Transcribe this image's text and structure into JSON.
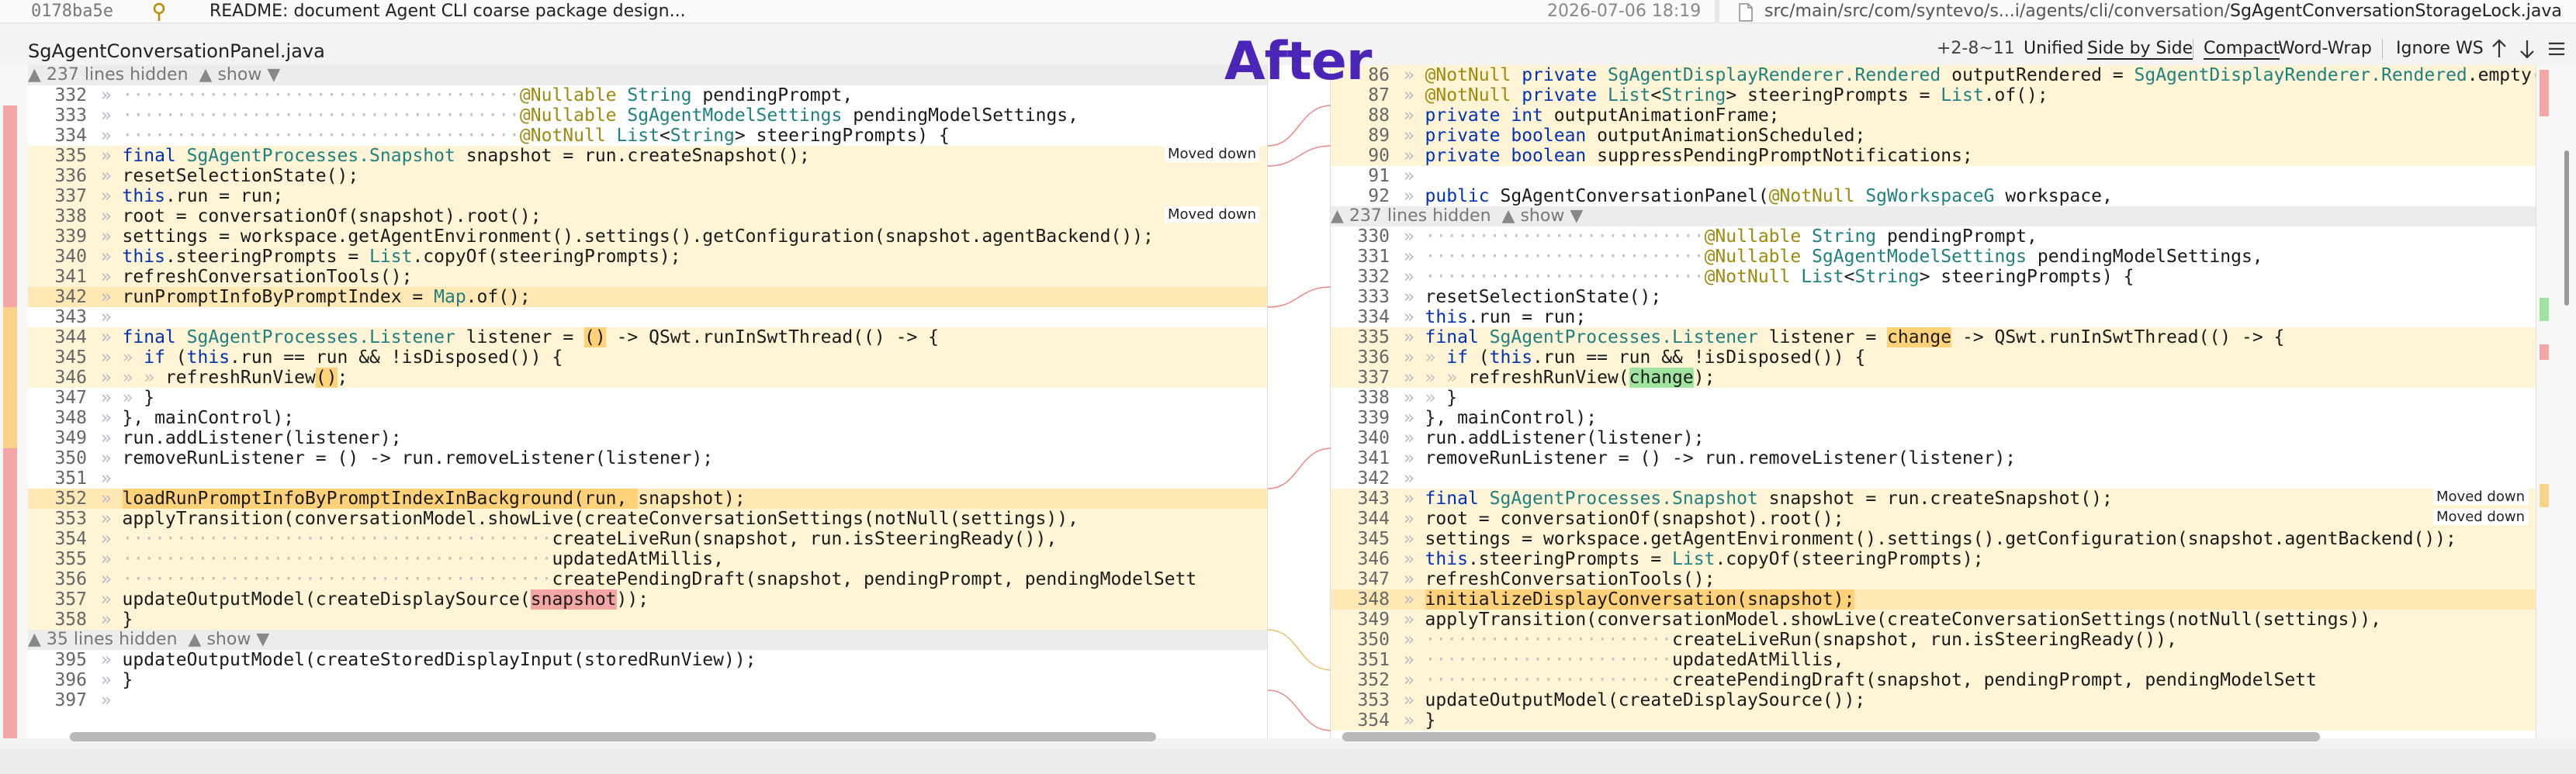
{
  "top_strip": {
    "commit_hash": "0178ba5e",
    "commit_message": "README: document Agent CLI coarse package design...",
    "commit_date": "2026-07-06 18:19",
    "path_prefix": "src/main/src/com/syntevo/s...i/agents/cli/conversation/",
    "path_file": "SgAgentConversationStorageLock.java"
  },
  "header": {
    "file_title": "SgAgentConversationPanel.java",
    "overlay_label": "After",
    "change_count": "+2-8~11",
    "unified": "Unified",
    "side_by_side": "Side by Side",
    "compact": "Compact",
    "word_wrap": "Word-Wrap",
    "ignore_ws": "Ignore WS",
    "icons": [
      "arrow-up-icon",
      "arrow-down-icon",
      "menu-icon"
    ]
  },
  "left_pane": {
    "fold_top": "237 lines hidden",
    "fold_top_show": "show",
    "lines": [
      {
        "n": "332",
        "text": "@Nullable String pendingPrompt,"
      },
      {
        "n": "333",
        "text": "@Nullable SgAgentModelSettings pendingModelSettings,"
      },
      {
        "n": "334",
        "text": "@NotNull List<String> steeringPrompts) {"
      },
      {
        "n": "335",
        "text": "final SgAgentProcesses.Snapshot snapshot = run.createSnapshot();",
        "tag": "Moved down"
      },
      {
        "n": "336",
        "text": "resetSelectionState();"
      },
      {
        "n": "337",
        "text": "this.run = run;"
      },
      {
        "n": "338",
        "text": "root = conversationOf(snapshot).root();",
        "tag": "Moved down"
      },
      {
        "n": "339",
        "text": "settings = workspace.getAgentEnvironment().settings().getConfiguration(snapshot.agentBackend());"
      },
      {
        "n": "340",
        "text": "this.steeringPrompts = List.copyOf(steeringPrompts);"
      },
      {
        "n": "341",
        "text": "refreshConversationTools();"
      },
      {
        "n": "342",
        "text": "runPromptInfoByPromptIndex = Map.of();"
      },
      {
        "n": "343",
        "text": ""
      },
      {
        "n": "344",
        "text": "final SgAgentProcesses.Listener listener = () -> QSwt.runInSwtThread(() -> {"
      },
      {
        "n": "345",
        "text": "if (this.run == run && !isDisposed()) {"
      },
      {
        "n": "346",
        "text": "refreshRunView();"
      },
      {
        "n": "347",
        "text": "}"
      },
      {
        "n": "348",
        "text": "}, mainControl);"
      },
      {
        "n": "349",
        "text": "run.addListener(listener);"
      },
      {
        "n": "350",
        "text": "removeRunListener = () -> run.removeListener(listener);"
      },
      {
        "n": "351",
        "text": ""
      },
      {
        "n": "352",
        "text": "loadRunPromptInfoByPromptIndexInBackground(run, snapshot);"
      },
      {
        "n": "353",
        "text": "applyTransition(conversationModel.showLive(createConversationSettings(notNull(settings)),"
      },
      {
        "n": "354",
        "text": "createLiveRun(snapshot, run.isSteeringReady()),"
      },
      {
        "n": "355",
        "text": "updatedAtMillis,"
      },
      {
        "n": "356",
        "text": "createPendingDraft(snapshot, pendingPrompt, pendingModelSett"
      },
      {
        "n": "357",
        "text": "updateOutputModel(createDisplaySource(snapshot));"
      },
      {
        "n": "358",
        "text": "}"
      }
    ],
    "fold_bottom": "35 lines hidden",
    "fold_bottom_show": "show",
    "tail": [
      {
        "n": "395",
        "text": "updateOutputModel(createStoredDisplayInput(storedRunView));"
      },
      {
        "n": "396",
        "text": "}"
      },
      {
        "n": "397",
        "text": ""
      }
    ]
  },
  "right_pane": {
    "head": [
      {
        "n": "86",
        "text": "@NotNull private SgAgentDisplayRenderer.Rendered outputRendered = SgAgentDisplayRenderer.Rendered.empty()"
      },
      {
        "n": "87",
        "text": "@NotNull private List<String> steeringPrompts = List.of();"
      },
      {
        "n": "88",
        "text": "private int outputAnimationFrame;"
      },
      {
        "n": "89",
        "text": "private boolean outputAnimationScheduled;"
      },
      {
        "n": "90",
        "text": "private boolean suppressPendingPromptNotifications;"
      },
      {
        "n": "91",
        "text": ""
      },
      {
        "n": "92",
        "text": "public SgAgentConversationPanel(@NotNull SgWorkspaceG workspace,"
      }
    ],
    "fold": "237 lines hidden",
    "fold_show": "show",
    "lines": [
      {
        "n": "330",
        "text": "@Nullable String pendingPrompt,"
      },
      {
        "n": "331",
        "text": "@Nullable SgAgentModelSettings pendingModelSettings,"
      },
      {
        "n": "332",
        "text": "@NotNull List<String> steeringPrompts) {"
      },
      {
        "n": "333",
        "text": "resetSelectionState();"
      },
      {
        "n": "334",
        "text": "this.run = run;"
      },
      {
        "n": "335",
        "text": "final SgAgentProcesses.Listener listener = change -> QSwt.runInSwtThread(() -> {"
      },
      {
        "n": "336",
        "text": "if (this.run == run && !isDisposed()) {"
      },
      {
        "n": "337",
        "text": "refreshRunView(change);"
      },
      {
        "n": "338",
        "text": "}"
      },
      {
        "n": "339",
        "text": "}, mainControl);"
      },
      {
        "n": "340",
        "text": "run.addListener(listener);"
      },
      {
        "n": "341",
        "text": "removeRunListener = () -> run.removeListener(listener);"
      },
      {
        "n": "342",
        "text": ""
      },
      {
        "n": "343",
        "text": "final SgAgentProcesses.Snapshot snapshot = run.createSnapshot();",
        "tag": "Moved down"
      },
      {
        "n": "344",
        "text": "root = conversationOf(snapshot).root();",
        "tag": "Moved down"
      },
      {
        "n": "345",
        "text": "settings = workspace.getAgentEnvironment().settings().getConfiguration(snapshot.agentBackend());"
      },
      {
        "n": "346",
        "text": "this.steeringPrompts = List.copyOf(steeringPrompts);"
      },
      {
        "n": "347",
        "text": "refreshConversationTools();"
      },
      {
        "n": "348",
        "text": "initializeDisplayConversation(snapshot);"
      },
      {
        "n": "349",
        "text": "applyTransition(conversationModel.showLive(createConversationSettings(notNull(settings)),"
      },
      {
        "n": "350",
        "text": "createLiveRun(snapshot, run.isSteeringReady()),"
      },
      {
        "n": "351",
        "text": "updatedAtMillis,"
      },
      {
        "n": "352",
        "text": "createPendingDraft(snapshot, pendingPrompt, pendingModelSett"
      },
      {
        "n": "353",
        "text": "updateOutputModel(createDisplaySource());"
      },
      {
        "n": "354",
        "text": "}"
      }
    ]
  },
  "colors": {
    "keyword": "#0033b3",
    "type": "#1f8080",
    "annotation": "#9e880d",
    "modified_bg": "#fff4d6",
    "added_bg": "#ffe8b3",
    "removed_bg": "#fbe3e3",
    "overlay": "#4b25b8"
  }
}
